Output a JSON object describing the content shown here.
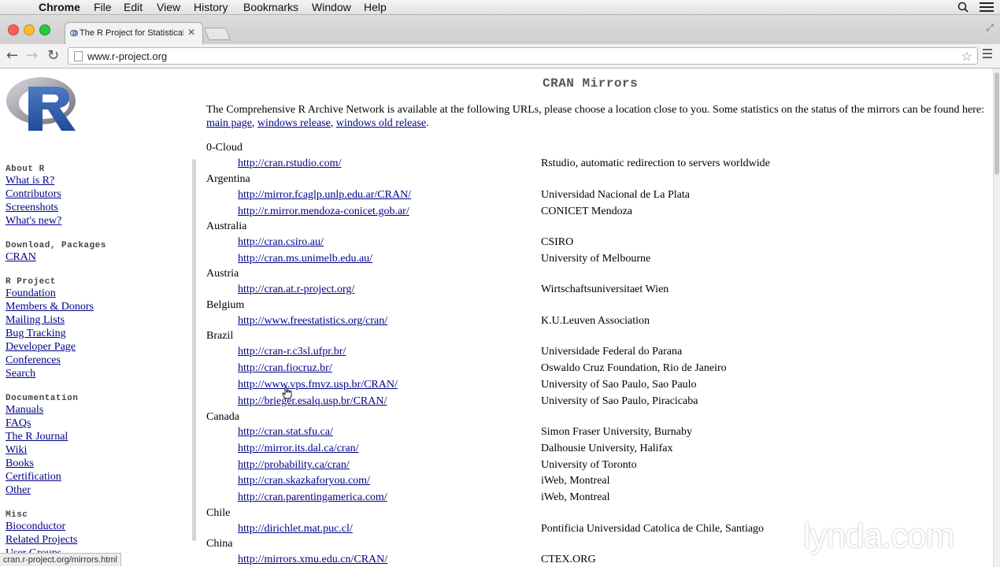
{
  "menubar": {
    "app": "Chrome",
    "items": [
      "File",
      "Edit",
      "View",
      "History",
      "Bookmarks",
      "Window",
      "Help"
    ]
  },
  "browser": {
    "tab_title": "The R Project for Statistical",
    "url": "www.r-project.org",
    "status_url": "cran.r-project.org/mirrors.html"
  },
  "sidebar": {
    "about_heading": "About R",
    "about_links": [
      "What is R?",
      "Contributors",
      "Screenshots",
      "What's new?"
    ],
    "download_heading": "Download, Packages",
    "download_links": [
      "CRAN"
    ],
    "project_heading": "R Project",
    "project_links": [
      "Foundation",
      "Members & Donors",
      "Mailing Lists",
      "Bug Tracking",
      "Developer Page",
      "Conferences",
      "Search"
    ],
    "doc_heading": "Documentation",
    "doc_links": [
      "Manuals",
      "FAQs",
      "The R Journal",
      "Wiki",
      "Books",
      "Certification",
      "Other"
    ],
    "misc_heading": "Misc",
    "misc_links": [
      "Bioconductor",
      "Related Projects",
      "User Groups"
    ]
  },
  "main": {
    "title": "CRAN Mirrors",
    "intro_text": "The Comprehensive R Archive Network is available at the following URLs, please choose a location close to you. Some statistics on the status of the mirrors can be found here:",
    "intro_links": [
      "main page",
      "windows release",
      "windows old release"
    ],
    "countries": [
      {
        "name": "0-Cloud",
        "mirrors": [
          [
            "http://cran.rstudio.com/",
            "Rstudio, automatic redirection to servers worldwide"
          ]
        ]
      },
      {
        "name": "Argentina",
        "mirrors": [
          [
            "http://mirror.fcaglp.unlp.edu.ar/CRAN/",
            "Universidad Nacional de La Plata"
          ],
          [
            "http://r.mirror.mendoza-conicet.gob.ar/",
            "CONICET Mendoza"
          ]
        ]
      },
      {
        "name": "Australia",
        "mirrors": [
          [
            "http://cran.csiro.au/",
            "CSIRO"
          ],
          [
            "http://cran.ms.unimelb.edu.au/",
            "University of Melbourne"
          ]
        ]
      },
      {
        "name": "Austria",
        "mirrors": [
          [
            "http://cran.at.r-project.org/",
            "Wirtschaftsuniversitaet Wien"
          ]
        ]
      },
      {
        "name": "Belgium",
        "mirrors": [
          [
            "http://www.freestatistics.org/cran/",
            "K.U.Leuven Association"
          ]
        ]
      },
      {
        "name": "Brazil",
        "mirrors": [
          [
            "http://cran-r.c3sl.ufpr.br/",
            "Universidade Federal do Parana"
          ],
          [
            "http://cran.fiocruz.br/",
            "Oswaldo Cruz Foundation, Rio de Janeiro"
          ],
          [
            "http://www.vps.fmvz.usp.br/CRAN/",
            "University of Sao Paulo, Sao Paulo"
          ],
          [
            "http://brieger.esalq.usp.br/CRAN/",
            "University of Sao Paulo, Piracicaba"
          ]
        ]
      },
      {
        "name": "Canada",
        "mirrors": [
          [
            "http://cran.stat.sfu.ca/",
            "Simon Fraser University, Burnaby"
          ],
          [
            "http://mirror.its.dal.ca/cran/",
            "Dalhousie University, Halifax"
          ],
          [
            "http://probability.ca/cran/",
            "University of Toronto"
          ],
          [
            "http://cran.skazkaforyou.com/",
            "iWeb, Montreal"
          ],
          [
            "http://cran.parentingamerica.com/",
            "iWeb, Montreal"
          ]
        ]
      },
      {
        "name": "Chile",
        "mirrors": [
          [
            "http://dirichlet.mat.puc.cl/",
            "Pontificia Universidad Catolica de Chile, Santiago"
          ]
        ]
      },
      {
        "name": "China",
        "mirrors": [
          [
            "http://mirrors.xmu.edu.cn/CRAN/",
            "CTEX.ORG"
          ]
        ]
      }
    ]
  },
  "watermark": "lynda.com"
}
